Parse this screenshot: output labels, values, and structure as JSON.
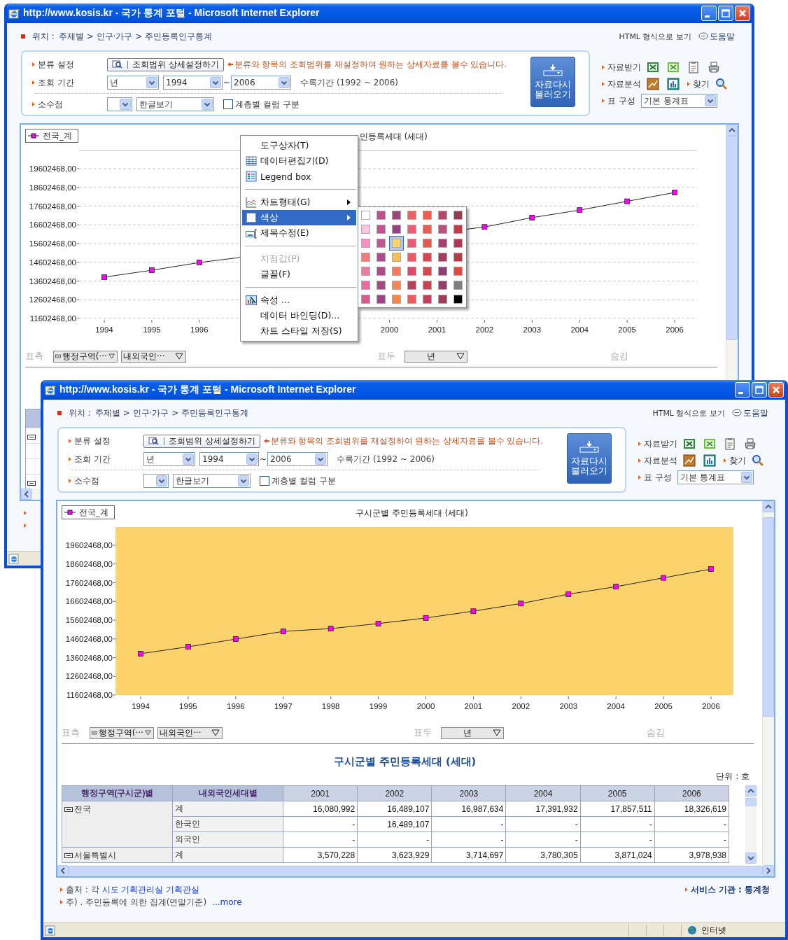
{
  "windows": [
    {
      "title": "http://www.kosis.kr - 국가 통계 포털 - Microsoft Internet Explorer",
      "location": {
        "label": "위치 :",
        "path": "주제별 > 인구·가구 > 주민등록인구통계"
      },
      "html_view": "HTML 형식으로 보기",
      "help": "도움말",
      "form": {
        "category_label": "분류 설정",
        "range_button": "조회범위 상세설정하기",
        "hint": "분류와 항목의 조회범위를 재설정하여 원하는 상세자료를 볼수 있습니다.",
        "period_label": "조회 기간",
        "period_unit": "년",
        "from": "1994",
        "tilde": "~",
        "to": "2006",
        "collected": "수록기간 (1992 ~ 2006)",
        "decimal_label": "소수점",
        "display": "한글보기",
        "hierarchy": {
          "label": "계층별 컬럼 구분",
          "checked": false
        },
        "reload": "자료다시 불러오기"
      },
      "tools": {
        "download": "자료받기",
        "analysis": "자료분석",
        "find": "찾기",
        "layout_label": "표 구성",
        "layout_value": "기본 통계표"
      },
      "chart": {
        "title": "민등록세대 (세대)",
        "chart_data": {
          "type": "line",
          "grid": true,
          "x": [
            1994,
            1995,
            1996,
            2002,
            2003,
            2004,
            2005,
            2006
          ],
          "xlim": [
            1993.47,
            2006.47
          ],
          "xticks": [
            1994,
            1995,
            1996,
            2000,
            2001,
            2002,
            2003,
            2004,
            2005,
            2006
          ],
          "series": [
            {
              "name": "전국_계",
              "color": "#ff00ff",
              "marker": "square",
              "values": [
                13810000,
                14180000,
                14590000,
                16490000,
                16990000,
                17390000,
                17860000,
                18330000
              ]
            }
          ],
          "ylim": [
            11602468,
            20574468
          ],
          "yticks": [
            {
              "value": 11602468,
              "label": "11602468,00"
            },
            {
              "value": 12602468,
              "label": "12602468,00"
            },
            {
              "value": 13602468,
              "label": "13602468,00"
            },
            {
              "value": 14602468,
              "label": "14602468,00"
            },
            {
              "value": 15602468,
              "label": "15602468,00"
            },
            {
              "value": 16602468,
              "label": "16602468,00"
            },
            {
              "value": 17602468,
              "label": "17602468,00"
            },
            {
              "value": 18602468,
              "label": "18602468,00"
            },
            {
              "value": 19602468,
              "label": "19602468,00"
            }
          ]
        }
      },
      "axis_controls": {
        "rows_label": "표측",
        "rows": [
          "행정구역(···",
          "내외국인···"
        ],
        "cols_label": "표두",
        "cols": [
          "년"
        ],
        "hidden_label": "숨김"
      },
      "context_menu": {
        "items": [
          {
            "kind": "item",
            "label": "도구상자(T)",
            "submenu": false,
            "selected": false,
            "disabled": false
          },
          {
            "kind": "item",
            "label": "데이터편집기(D)",
            "submenu": false,
            "selected": false,
            "disabled": false
          },
          {
            "kind": "item",
            "label": "Legend box",
            "submenu": false,
            "selected": false,
            "disabled": false
          },
          {
            "kind": "separator"
          },
          {
            "kind": "item",
            "label": "차트형태(G)",
            "submenu": true,
            "selected": false,
            "disabled": false
          },
          {
            "kind": "item",
            "label": "색상",
            "submenu": true,
            "selected": true,
            "disabled": false
          },
          {
            "kind": "item",
            "label": "제목수정(E)",
            "submenu": false,
            "selected": false,
            "disabled": false
          },
          {
            "kind": "separator"
          },
          {
            "kind": "item",
            "label": "지점값(P)",
            "submenu": false,
            "selected": false,
            "disabled": true
          },
          {
            "kind": "item",
            "label": "글꼴(F)",
            "submenu": false,
            "selected": false,
            "disabled": false
          },
          {
            "kind": "separator"
          },
          {
            "kind": "item",
            "label": "속성 ...",
            "submenu": false,
            "selected": false,
            "disabled": false
          },
          {
            "kind": "item",
            "label": "데이터 바인딩(D)...",
            "submenu": false,
            "selected": false,
            "disabled": false
          },
          {
            "kind": "item",
            "label": "차트 스타일 저장(S)",
            "submenu": false,
            "selected": false,
            "disabled": false
          }
        ]
      },
      "palette": {
        "rows": [
          [
            {
              "color": "#ffffff",
              "selected": false
            },
            {
              "color": "#c0508a",
              "selected": false
            },
            {
              "color": "#9a4a7a",
              "selected": false
            },
            {
              "color": "#f26160",
              "selected": false
            },
            {
              "color": "#f55a48",
              "selected": false
            },
            {
              "color": "#b04870",
              "selected": false
            },
            {
              "color": "#9a3c50",
              "selected": false
            }
          ],
          [
            {
              "color": "#fcc8e0",
              "selected": false
            },
            {
              "color": "#cc5090",
              "selected": false
            },
            {
              "color": "#9a4085",
              "selected": false
            },
            {
              "color": "#f25c78",
              "selected": false
            },
            {
              "color": "#ee5a50",
              "selected": false
            },
            {
              "color": "#c0507a",
              "selected": false
            },
            {
              "color": "#c83848",
              "selected": false
            }
          ],
          [
            {
              "color": "#f990c0",
              "selected": false
            },
            {
              "color": "#c45590",
              "selected": false
            },
            {
              "color": "#fcd36a",
              "selected": true
            },
            {
              "color": "#ec5a78",
              "selected": false
            },
            {
              "color": "#e4584c",
              "selected": false
            },
            {
              "color": "#a84070",
              "selected": false
            },
            {
              "color": "#b43650",
              "selected": false
            }
          ],
          [
            {
              "color": "#f47a7a",
              "selected": false
            },
            {
              "color": "#b04a90",
              "selected": false
            },
            {
              "color": "#fcc050",
              "selected": false
            },
            {
              "color": "#f05860",
              "selected": false
            },
            {
              "color": "#e04450",
              "selected": false
            },
            {
              "color": "#a83c60",
              "selected": false
            },
            {
              "color": "#b83a48",
              "selected": false
            }
          ],
          [
            {
              "color": "#ef7aa0",
              "selected": false
            },
            {
              "color": "#b04a88",
              "selected": false
            },
            {
              "color": "#fb7a58",
              "selected": false
            },
            {
              "color": "#dc4a6a",
              "selected": false
            },
            {
              "color": "#d84848",
              "selected": false
            },
            {
              "color": "#903c78",
              "selected": false
            },
            {
              "color": "#e04840",
              "selected": false
            }
          ],
          [
            {
              "color": "#ed6aa0",
              "selected": false
            },
            {
              "color": "#a44a80",
              "selected": false
            },
            {
              "color": "#fb8458",
              "selected": false
            },
            {
              "color": "#bc4060",
              "selected": false
            },
            {
              "color": "#d04050",
              "selected": false
            },
            {
              "color": "#983c70",
              "selected": false
            },
            {
              "color": "#808080",
              "selected": false
            }
          ],
          [
            {
              "color": "#d85a90",
              "selected": false
            },
            {
              "color": "#a04488",
              "selected": false
            },
            {
              "color": "#fb8448",
              "selected": false
            },
            {
              "color": "#f45a5a",
              "selected": false
            },
            {
              "color": "#c83c58",
              "selected": false
            },
            {
              "color": "#a03c58",
              "selected": false
            },
            {
              "color": "#000000",
              "selected": false
            }
          ]
        ]
      }
    },
    {
      "title": "http://www.kosis.kr - 국가 통계 포털 - Microsoft Internet Explorer",
      "location": {
        "label": "위치 :",
        "path": "주제별 > 인구·가구 > 주민등록인구통계"
      },
      "html_view": "HTML 형식으로 보기",
      "help": "도움말",
      "form": {
        "category_label": "분류 설정",
        "range_button": "조회범위 상세설정하기",
        "hint": "분류와 항목의 조회범위를 재설정하여 원하는 상세자료를 볼수 있습니다.",
        "period_label": "조회 기간",
        "period_unit": "년",
        "from": "1994",
        "tilde": "~",
        "to": "2006",
        "collected": "수록기간 (1992 ~ 2006)",
        "decimal_label": "소수점",
        "display": "한글보기",
        "hierarchy": {
          "label": "계층별 컬럼 구분",
          "checked": false
        },
        "reload": "자료다시 불러오기"
      },
      "tools": {
        "download": "자료받기",
        "analysis": "자료분석",
        "find": "찾기",
        "layout_label": "표 구성",
        "layout_value": "기본 통계표"
      },
      "chart": {
        "title": "구시군별 주민등록세대 (세대)",
        "chart_data": {
          "type": "line",
          "categories": [
            "1994",
            "1995",
            "1996",
            "1997",
            "1998",
            "1999",
            "2000",
            "2001",
            "2002",
            "2003",
            "2004",
            "2005",
            "2006"
          ],
          "series": [
            {
              "name": "전국_계",
              "color": "#ff00ff",
              "marker": "square",
              "values": [
                13810000,
                14180000,
                14590000,
                15000000,
                15150000,
                15420000,
                15720000,
                16080000,
                16490000,
                16990000,
                17390000,
                17860000,
                18330000
              ]
            }
          ],
          "ylim": [
            11602468,
            20574468
          ],
          "yticks": [
            {
              "value": 11602468,
              "label": "11602468,00"
            },
            {
              "value": 12602468,
              "label": "12602468,00"
            },
            {
              "value": 13602468,
              "label": "13602468,00"
            },
            {
              "value": 14602468,
              "label": "14602468,00"
            },
            {
              "value": 15602468,
              "label": "15602468,00"
            },
            {
              "value": 16602468,
              "label": "16602468,00"
            },
            {
              "value": 17602468,
              "label": "17602468,00"
            },
            {
              "value": 18602468,
              "label": "18602468,00"
            },
            {
              "value": 19602468,
              "label": "19602468,00"
            }
          ]
        }
      },
      "axis_controls": {
        "rows_label": "표측",
        "rows": [
          "행정구역(···",
          "내외국인···"
        ],
        "cols_label": "표두",
        "cols": [
          "년"
        ],
        "hidden_label": "숨김"
      },
      "table": {
        "title": "구시군별 주민등록세대 (세대)",
        "unit": "단위 : 호",
        "columns": [
          "행정구역(구시군)별",
          "내외국인세대별",
          "2001",
          "2002",
          "2003",
          "2004",
          "2005",
          "2006"
        ],
        "groups": [
          {
            "region": "전국",
            "expanded": true,
            "rows": [
              {
                "type": "계",
                "values": [
                  "16,080,992",
                  "16,489,107",
                  "16,987,634",
                  "17,391,932",
                  "17,857,511",
                  "18,326,619"
                ]
              },
              {
                "type": "한국인",
                "values": [
                  "-",
                  "16,489,107",
                  "-",
                  "-",
                  "-",
                  "-"
                ]
              },
              {
                "type": "외국인",
                "values": [
                  "-",
                  "-",
                  "-",
                  "-",
                  "-",
                  "-"
                ]
              }
            ]
          },
          {
            "region": "서울특별시",
            "expanded": true,
            "rows": [
              {
                "type": "계",
                "values": [
                  "3,570,228",
                  "3,623,929",
                  "3,714,697",
                  "3,780,305",
                  "3,871,024",
                  "3,978,938"
                ]
              }
            ]
          }
        ]
      },
      "footer": {
        "source_label": "출처 :",
        "source": "각 시도 기획관리실 기획관실",
        "note": "주) . 주민등록에 의한 집계(연말기준)",
        "more": "...more",
        "agency": "서비스 기관 : 통계청"
      },
      "status": "인터넷"
    }
  ]
}
